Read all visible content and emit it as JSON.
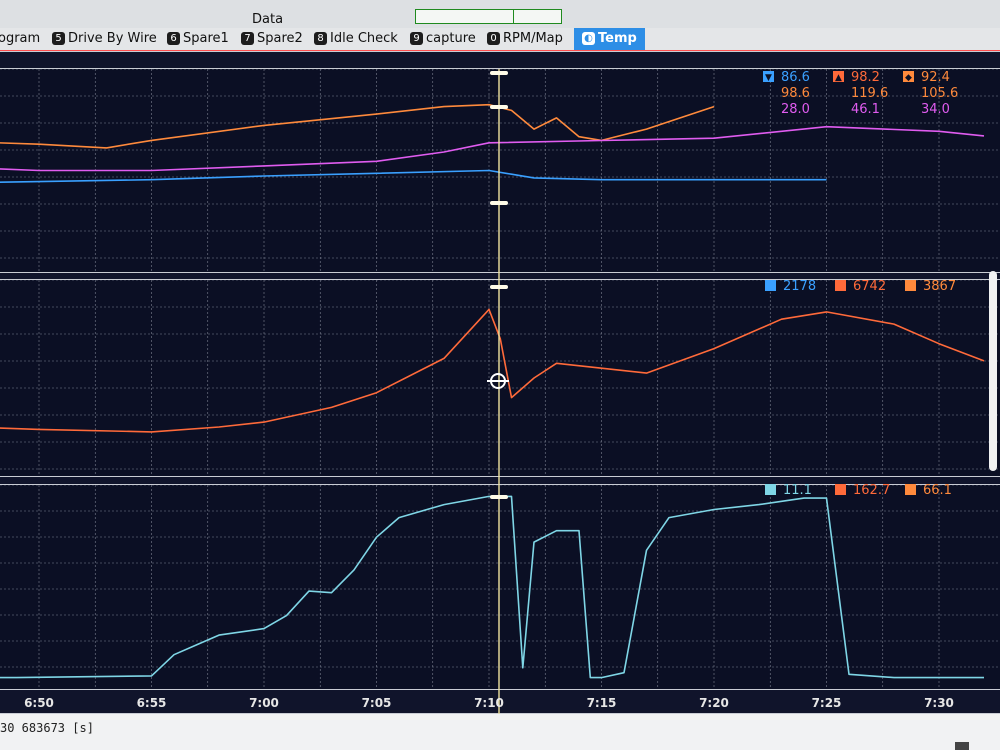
{
  "window": {
    "data_label": "Data",
    "status": "30 683673 [s]"
  },
  "tabs": [
    {
      "num": "",
      "label": "ogram"
    },
    {
      "num": "5",
      "label": "Drive By Wire"
    },
    {
      "num": "6",
      "label": "Spare1"
    },
    {
      "num": "7",
      "label": "Spare2"
    },
    {
      "num": "8",
      "label": "Idle Check"
    },
    {
      "num": "9",
      "label": "capture"
    },
    {
      "num": "0",
      "label": "RPM/Map"
    },
    {
      "num": "◐",
      "label": "Temp"
    }
  ],
  "colors": {
    "background": "#0b0f24",
    "grid": "#7d8191",
    "orange": "#ff8a3c",
    "blue": "#3aa0ff",
    "magenta": "#e05cf0",
    "rpm": "#ff6a3a",
    "cyan": "#7fd6e6",
    "cursor": "#f0e3a0"
  },
  "chart_data": [
    {
      "type": "line",
      "panel": "temperatures",
      "x_ticks": [
        "6:50",
        "6:55",
        "7:00",
        "7:05",
        "7:10",
        "7:15",
        "7:20",
        "7:25",
        "7:30"
      ],
      "cursor_time": "7:10",
      "series": [
        {
          "color": "orange",
          "x": [
            "6:45",
            "6:50",
            "6:53",
            "6:55",
            "7:00",
            "7:05",
            "7:08",
            "7:10",
            "7:11",
            "7:12",
            "7:13",
            "7:14",
            "7:15",
            "7:17",
            "7:20"
          ],
          "y": [
            105,
            104,
            103,
            105,
            109,
            112,
            114,
            114.5,
            113,
            108,
            111,
            106,
            105,
            108,
            114
          ]
        },
        {
          "color": "blue",
          "x": [
            "6:45",
            "6:50",
            "6:55",
            "7:00",
            "7:05",
            "7:10",
            "7:11",
            "7:12",
            "7:15",
            "7:20",
            "7:25"
          ],
          "y": [
            88,
            89,
            90,
            92,
            93.5,
            95,
            93,
            91,
            90,
            90,
            90
          ]
        },
        {
          "color": "magenta",
          "x": [
            "6:45",
            "6:50",
            "6:55",
            "7:00",
            "7:05",
            "7:08",
            "7:10",
            "7:15",
            "7:20",
            "7:25",
            "7:30",
            "7:32"
          ],
          "y": [
            43,
            42,
            42,
            43,
            44,
            46,
            48,
            48.5,
            49,
            51.5,
            50.5,
            49.5
          ]
        }
      ],
      "legend": [
        {
          "color": "blue",
          "marker": "▼",
          "value": "86.6"
        },
        {
          "color": "rpm",
          "marker": "▲",
          "value": "98.2"
        },
        {
          "color": "orange",
          "marker": "◆",
          "value": "92.4"
        },
        {
          "color": "orange",
          "value": "98.6"
        },
        {
          "color": "orange",
          "value": "119.6"
        },
        {
          "color": "orange",
          "value": "105.6"
        },
        {
          "color": "magenta",
          "value": "28.0"
        },
        {
          "color": "magenta",
          "value": "46.1"
        },
        {
          "color": "magenta",
          "value": "34.0"
        }
      ]
    },
    {
      "type": "line",
      "panel": "rpm",
      "series": [
        {
          "color": "rpm",
          "x": [
            "6:45",
            "6:47",
            "6:50",
            "6:55",
            "6:58",
            "7:00",
            "7:03",
            "7:05",
            "7:08",
            "7:10",
            "7:10.5",
            "7:11",
            "7:12",
            "7:13",
            "7:15",
            "7:17",
            "7:20",
            "7:23",
            "7:25",
            "7:28",
            "7:30",
            "7:32"
          ],
          "y": [
            3900,
            4000,
            3950,
            3900,
            4000,
            4100,
            4400,
            4700,
            5400,
            6400,
            5800,
            4600,
            5000,
            5300,
            5200,
            5100,
            5600,
            6200,
            6350,
            6100,
            5700,
            5350
          ]
        }
      ],
      "legend": [
        {
          "color": "blue",
          "value": "2178"
        },
        {
          "color": "rpm",
          "value": "6742"
        },
        {
          "color": "orange",
          "value": "3867"
        }
      ]
    },
    {
      "type": "line",
      "panel": "throttle",
      "series": [
        {
          "color": "cyan",
          "x": [
            "6:45",
            "6:46",
            "6:46.5",
            "6:47",
            "6:48",
            "6:49",
            "6:55",
            "6:56",
            "6:57",
            "6:58",
            "7:00",
            "7:01",
            "7:02",
            "7:03",
            "7:04",
            "7:05",
            "7:06",
            "7:08",
            "7:10",
            "7:11",
            "7:11.5",
            "7:12",
            "7:13",
            "7:14",
            "7:14.5",
            "7:15",
            "7:16",
            "7:17",
            "7:18",
            "7:20",
            "7:22",
            "7:24",
            "7:25",
            "7:26",
            "7:28",
            "7:30",
            "7:32"
          ],
          "y": [
            20,
            40,
            55,
            20,
            2,
            2,
            3,
            16,
            22,
            28,
            32,
            40,
            55,
            54,
            68,
            88,
            100,
            108,
            113,
            113,
            8,
            85,
            92,
            92,
            2,
            2,
            5,
            80,
            100,
            105,
            108,
            112,
            112,
            4,
            2,
            2,
            2
          ]
        }
      ],
      "legend": [
        {
          "color": "cyan",
          "value": "11.1"
        },
        {
          "color": "rpm",
          "value": "162.7"
        },
        {
          "color": "orange",
          "value": "66.1"
        }
      ]
    }
  ]
}
